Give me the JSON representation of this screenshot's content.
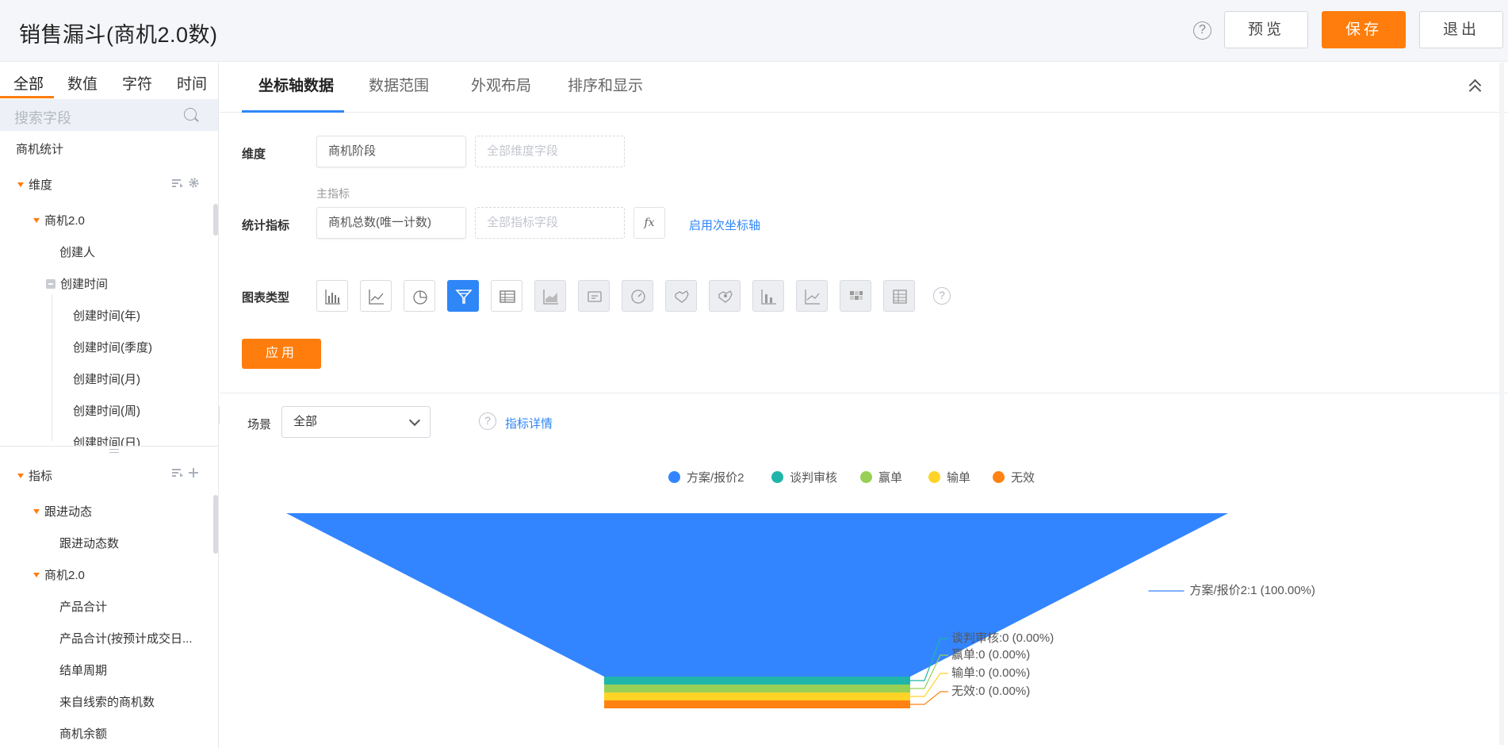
{
  "header": {
    "title": "销售漏斗(商机2.0数)",
    "help_icon": "?",
    "preview_label": "预览",
    "save_label": "保存",
    "exit_label": "退出"
  },
  "sidebar": {
    "tabs": [
      "全部",
      "数值",
      "字符",
      "时间"
    ],
    "search_placeholder": "搜索字段",
    "root": "商机统计",
    "dimension_group": "维度",
    "dimension_sub": "商机2.0",
    "dimension_items": [
      "创建人",
      "创建时间"
    ],
    "time_children": [
      "创建时间(年)",
      "创建时间(季度)",
      "创建时间(月)",
      "创建时间(周)",
      "创建时间(日)"
    ],
    "metric_group": "指标",
    "metric_sub1": "跟进动态",
    "metric_sub1_items": [
      "跟进动态数"
    ],
    "metric_sub2": "商机2.0",
    "metric_sub2_items": [
      "产品合计",
      "产品合计(按预计成交日...",
      "结单周期",
      "来自线索的商机数",
      "商机余额"
    ]
  },
  "main": {
    "tabs": [
      "坐标轴数据",
      "数据范围",
      "外观布局",
      "排序和显示"
    ],
    "dimension_label": "维度",
    "dimension_value": "商机阶段",
    "dimension_placeholder": "全部维度字段",
    "primary_metric_label": "主指标",
    "metric_label": "统计指标",
    "metric_value": "商机总数(唯一计数)",
    "metric_placeholder": "全部指标字段",
    "fx_label": "fx",
    "secondary_axis_link": "启用次坐标轴",
    "chart_type_label": "图表类型",
    "chart_types": [
      "bar-chart-icon",
      "line-chart-icon",
      "pie-chart-icon",
      "funnel-chart-icon",
      "table-chart-icon",
      "area-chart-icon",
      "card-icon",
      "gauge-icon",
      "map-icon",
      "map-bubble-icon",
      "stacked-bar-icon",
      "combo-chart-icon",
      "heatmap-icon",
      "pivot-table-icon"
    ],
    "apply_label": "应用",
    "scene_label": "场景",
    "scene_value": "全部",
    "detail_link": "指标详情"
  },
  "chart_data": {
    "type": "funnel",
    "categories": [
      "方案/报价2",
      "谈判审核",
      "赢单",
      "输单",
      "无效"
    ],
    "values": [
      1,
      0,
      0,
      0,
      0
    ],
    "percents": [
      "100.00%",
      "0.00%",
      "0.00%",
      "0.00%",
      "0.00%"
    ],
    "labels": [
      "方案/报价2:1 (100.00%)",
      "谈判审核:0 (0.00%)",
      "赢单:0 (0.00%)",
      "输单:0 (0.00%)",
      "无效:0 (0.00%)"
    ],
    "colors": [
      "#3385ff",
      "#1fb5a8",
      "#98cf55",
      "#ffd427",
      "#ff8213"
    ],
    "legend": "top-center"
  }
}
